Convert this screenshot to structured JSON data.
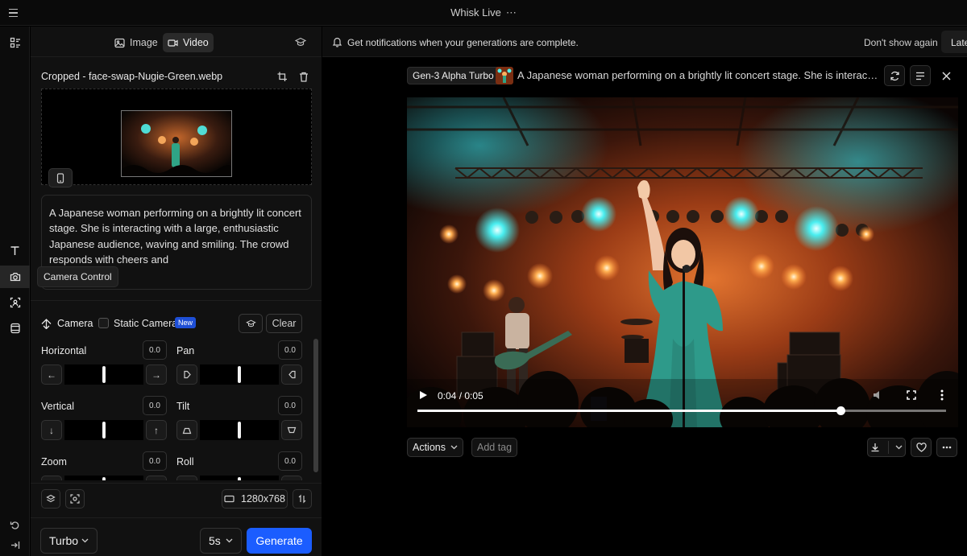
{
  "app": {
    "title": "Whisk Live",
    "title_more": "⋯"
  },
  "mode_tabs": [
    {
      "label": "Image",
      "active": false
    },
    {
      "label": "Video",
      "active": true
    }
  ],
  "notification": {
    "text": "Get notifications when your generations are complete.",
    "dont_show": "Don't show again",
    "later": "Later"
  },
  "source": {
    "file_name": "Cropped - face-swap-Nugie-Green.webp"
  },
  "prompt": {
    "text": "A Japanese woman performing on a brightly lit concert stage. She is interacting with a large, enthusiastic Japanese audience, waving and smiling. The crowd responds with cheers and"
  },
  "tooltip": {
    "text": "Camera Control"
  },
  "camera": {
    "label": "Camera",
    "static_label": "Static Camera",
    "new_badge": "New",
    "clear_label": "Clear",
    "controls": {
      "horizontal": {
        "label": "Horizontal",
        "value": "0.0"
      },
      "pan": {
        "label": "Pan",
        "value": "0.0"
      },
      "vertical": {
        "label": "Vertical",
        "value": "0.0"
      },
      "tilt": {
        "label": "Tilt",
        "value": "0.0"
      },
      "zoom": {
        "label": "Zoom",
        "value": "0.0"
      },
      "roll": {
        "label": "Roll",
        "value": "0.0"
      }
    }
  },
  "output": {
    "resolution": "1280x768",
    "model": "Turbo",
    "duration": "5s",
    "generate_label": "Generate"
  },
  "video": {
    "model_tag": "Gen-3 Alpha Turbo",
    "title": "A Japanese woman performing on a brightly lit concert stage. She is interacting with a large, enthusiastic Japanese audience",
    "time_display": "0:04 / 0:05",
    "progress": 0.8
  },
  "video_actions": {
    "actions_label": "Actions",
    "add_tag_label": "Add tag"
  },
  "colors": {
    "accent": "#1b5dff",
    "badge": "#1e4fd6"
  }
}
